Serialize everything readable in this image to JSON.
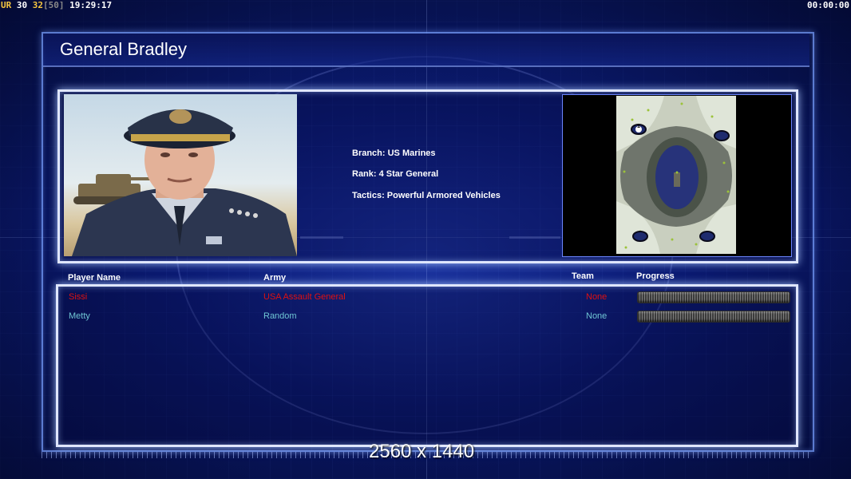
{
  "hud": {
    "ur_label": "UR",
    "fps_value": "30",
    "fps_target": "32",
    "fps_max": "[50]",
    "clock": "19:29:17",
    "elapsed": "00:00:00"
  },
  "title": "General Bradley",
  "general": {
    "branch": "Branch: US Marines",
    "rank": "Rank: 4 Star General",
    "tactics": "Tactics: Powerful Armored Vehicles"
  },
  "minimap": {
    "start_marker": "1"
  },
  "players_table": {
    "headers": {
      "player": "Player Name",
      "army": "Army",
      "team": "Team",
      "progress": "Progress"
    },
    "rows": [
      {
        "name": "Sissi",
        "army": "USA Assault General",
        "team": "None",
        "color": "#e01010",
        "progress": 1.0
      },
      {
        "name": "Metty",
        "army": "Random",
        "team": "None",
        "color": "#6fc6d4",
        "progress": 1.0
      }
    ]
  },
  "resolution": "2560 x 1440",
  "colors": {
    "hud_accent": "#f6c640",
    "panel_border": "#dfe6ff",
    "background": "#0a1a6a"
  }
}
